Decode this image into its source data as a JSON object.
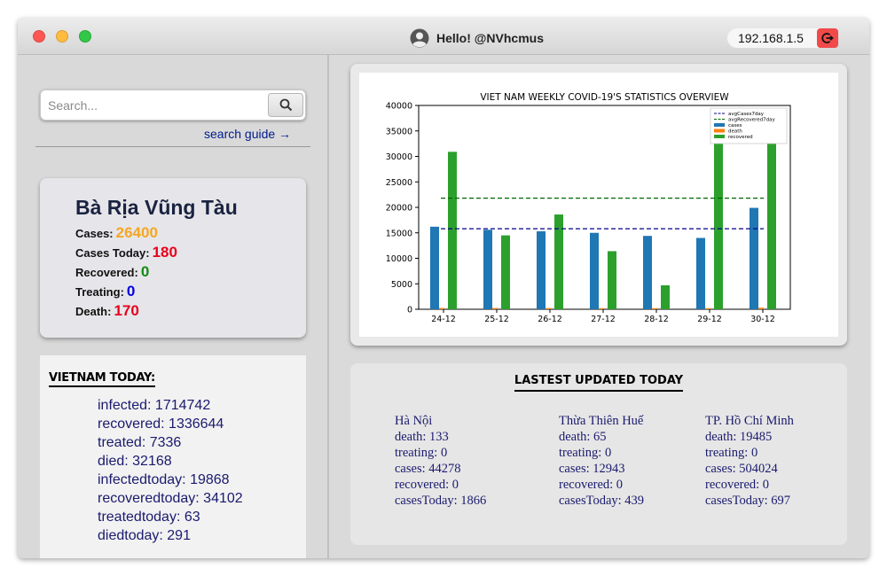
{
  "window": {
    "title": "Hello! @NVhcmus",
    "ip": "192.168.1.5"
  },
  "search": {
    "placeholder": "Search...",
    "guide_label": "search guide →"
  },
  "province": {
    "name": "Bà Rịa Vũng Tàu",
    "stats": [
      {
        "label": "Cases:",
        "value": "26400",
        "color": "#f5a623"
      },
      {
        "label": "Cases Today:",
        "value": "180",
        "color": "#e8001c"
      },
      {
        "label": "Recovered:",
        "value": "0",
        "color": "#138a13"
      },
      {
        "label": "Treating:",
        "value": "0",
        "color": "#0000e0"
      },
      {
        "label": "Death:",
        "value": "170",
        "color": "#e8001c"
      }
    ]
  },
  "vietnam_today": {
    "title": "VIETNAM TODAY:",
    "items": [
      "infected: 1714742",
      "recovered: 1336644",
      "treated: 7336",
      "died: 32168",
      "infectedtoday: 19868",
      "recoveredtoday: 34102",
      "treatedtoday: 63",
      "diedtoday: 291"
    ]
  },
  "latest": {
    "title": "LASTEST UPDATED TODAY",
    "columns": [
      {
        "name": "Hà Nội",
        "death": "death: 133",
        "treating": "treating: 0",
        "cases": "cases: 44278",
        "recovered": "recovered: 0",
        "casesToday": "casesToday: 1866"
      },
      {
        "name": "Thừa Thiên Huế",
        "death": "death: 65",
        "treating": "treating: 0",
        "cases": "cases: 12943",
        "recovered": "recovered: 0",
        "casesToday": "casesToday: 439"
      },
      {
        "name": "TP. Hồ Chí Minh",
        "death": "death: 19485",
        "treating": "treating: 0",
        "cases": "cases: 504024",
        "recovered": "recovered: 0",
        "casesToday": "casesToday: 697"
      }
    ]
  },
  "chart_data": {
    "type": "bar",
    "title": "VIET NAM WEEKLY COVID-19'S STATISTICS OVERVIEW",
    "categories": [
      "24-12",
      "25-12",
      "26-12",
      "27-12",
      "28-12",
      "29-12",
      "30-12"
    ],
    "ylim": [
      0,
      40000
    ],
    "yticks": [
      0,
      5000,
      10000,
      15000,
      20000,
      25000,
      30000,
      35000,
      40000
    ],
    "series": [
      {
        "name": "cases",
        "color": "#1f77b4",
        "values": [
          16200,
          15600,
          15300,
          15000,
          14400,
          14000,
          19900
        ]
      },
      {
        "name": "death",
        "color": "#ff7f0e",
        "values": [
          250,
          240,
          230,
          220,
          210,
          215,
          300
        ]
      },
      {
        "name": "recovered",
        "color": "#2ca02c",
        "values": [
          30900,
          14500,
          18600,
          11400,
          4700,
          35000,
          34200
        ]
      }
    ],
    "reference_lines": [
      {
        "name": "avgCases7day",
        "value": 15800,
        "color": "#00008b",
        "style": "dashed"
      },
      {
        "name": "avgRecovered7day",
        "value": 21800,
        "color": "#006400",
        "style": "dashed"
      }
    ],
    "legend": "top-right",
    "grid": false
  }
}
